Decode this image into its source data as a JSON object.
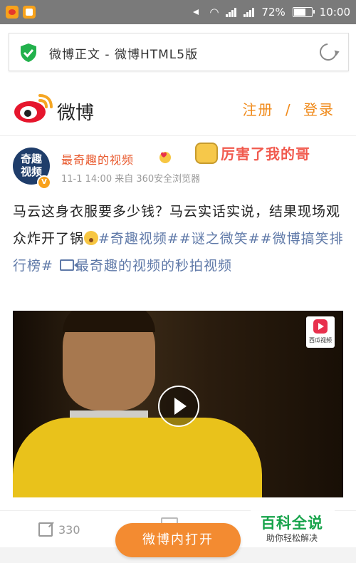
{
  "status_bar": {
    "battery_percent": "72%",
    "battery_level": 0.72,
    "time": "10:00",
    "icons": [
      "weibo-app-icon",
      "photo-app-icon",
      "mute-icon",
      "wifi-icon",
      "signal-icon",
      "signal-icon",
      "battery-icon"
    ]
  },
  "browser": {
    "url_text": "微博正文 - 微博HTML5版",
    "secure_icon": "shield-check-icon",
    "reload_icon": "reload-icon",
    "secure_color": "#22b14c"
  },
  "header": {
    "app_name": "微博",
    "register": "注册",
    "separator": "/",
    "login": "登录",
    "accent_color": "#f08a1a"
  },
  "post": {
    "avatar_text_line1": "奇趣",
    "avatar_text_line2": "视频",
    "verified_badge": "V",
    "author": "最奇趣的视频",
    "meta": "11-1 14:00 来自 360安全浏览器",
    "sticker_text": "厉害了我的哥",
    "text_part1": "马云这身衣服要多少钱？马云实话实说，结果现场观众炸开了锅",
    "tag1": "#奇趣视频#",
    "tag2": "#谜之微笑#",
    "tag3": "#微博搞笑排行榜#",
    "video_link": "最奇趣的视频的秒拍视频"
  },
  "video": {
    "source_label": "西瓜视频"
  },
  "actions": {
    "share_count": "330",
    "open_in_app": "微博内打开"
  },
  "watermark": {
    "title": "百科全说",
    "subtitle": "助你轻松解决"
  }
}
